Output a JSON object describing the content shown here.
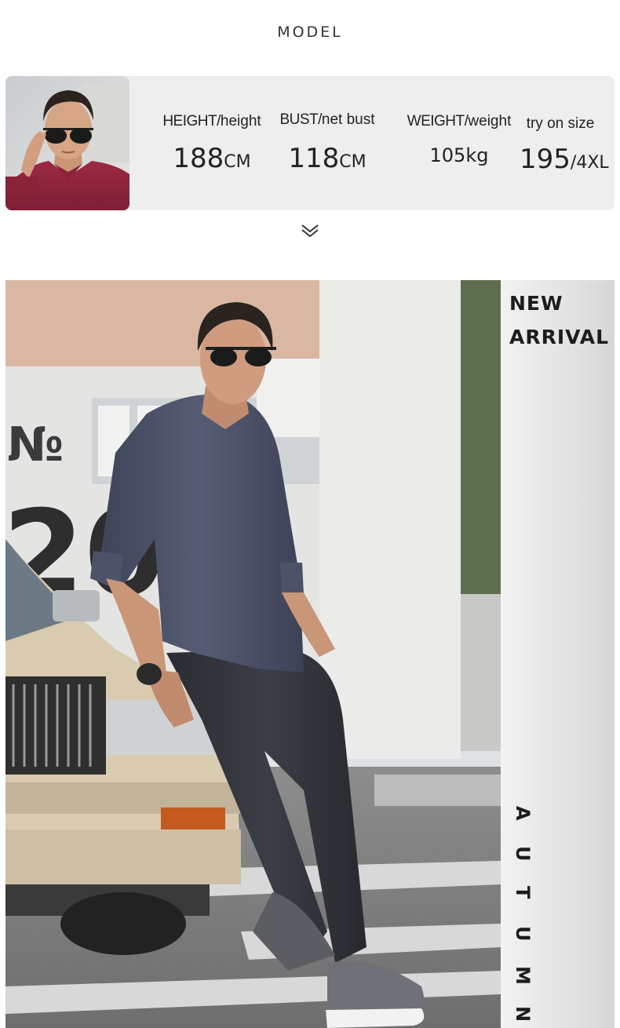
{
  "section_title": "MODEL",
  "model": {
    "photo_icon": "model-portrait-photo",
    "stats": [
      {
        "label_caps": "HEIGHT/",
        "label_lower": "height",
        "value": "188",
        "unit": "CM"
      },
      {
        "label_caps": "BUST/",
        "label_lower": "net bust",
        "value": "118",
        "unit": "CM"
      },
      {
        "label_caps": "WEIGHT/",
        "label_lower": "weight",
        "value": "105kg",
        "unit": ""
      },
      {
        "label_caps": "",
        "label_lower": "try on size",
        "value": "195",
        "unit": "/4XL"
      }
    ]
  },
  "scroll_hint_icon": "double-chevron-down-icon",
  "hero": {
    "photo_icon": "model-leaning-on-car-photo",
    "new_arrival_line1": "NEW",
    "new_arrival_line2": "ARRIVAL",
    "season_letters": [
      "A",
      "U",
      "T",
      "U",
      "M",
      "N"
    ]
  },
  "colors": {
    "card_bg": "#eeeeee",
    "text_dark": "#222222",
    "shirt": "#4a5068",
    "jeans": "#2e3036",
    "car": "#d9cbb0"
  }
}
